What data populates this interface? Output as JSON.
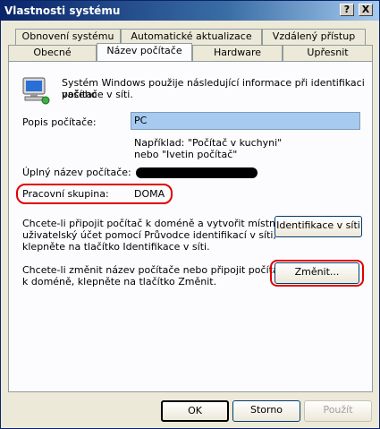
{
  "window": {
    "title": "Vlastnosti systému",
    "help_button": "?",
    "close_button": "X"
  },
  "tabs": {
    "row1": [
      {
        "label": "Obnovení systému"
      },
      {
        "label": "Automatické aktualizace"
      },
      {
        "label": "Vzdálený přístup"
      }
    ],
    "row2": [
      {
        "label": "Obecné"
      },
      {
        "label": "Název počítače",
        "active": true
      },
      {
        "label": "Hardware"
      },
      {
        "label": "Upřesnit"
      }
    ]
  },
  "content": {
    "intro_text_line1": "Systém Windows použije následující informace při identifikaci vašeho",
    "intro_text_line2": "počítače v síti.",
    "description_label": "Popis počítače:",
    "description_value": "PC",
    "example_line1": "Například: \"Počítač v kuchyni\"",
    "example_line2": "nebo \"Ivetin počítač\"",
    "full_name_label": "Úplný název počítače:",
    "workgroup_label": "Pracovní skupina:",
    "workgroup_value": "DOMA",
    "network_id_text_line1": "Chcete-li připojit počítač k doméně a vytvořit místní",
    "network_id_text_line2": "uživatelský účet pomocí Průvodce identifikací v síti,",
    "network_id_text_line3": "klepněte na tlačítko Identifikace v síti.",
    "network_id_button": "Identifikace v síti",
    "change_text_line1": "Chcete-li změnit název počítače nebo připojit počítač",
    "change_text_line2": "k doméně, klepněte na tlačítko Změnit.",
    "change_button": "Změnit..."
  },
  "footer": {
    "ok_button": "OK",
    "cancel_button": "Storno",
    "apply_button": "Použít"
  }
}
